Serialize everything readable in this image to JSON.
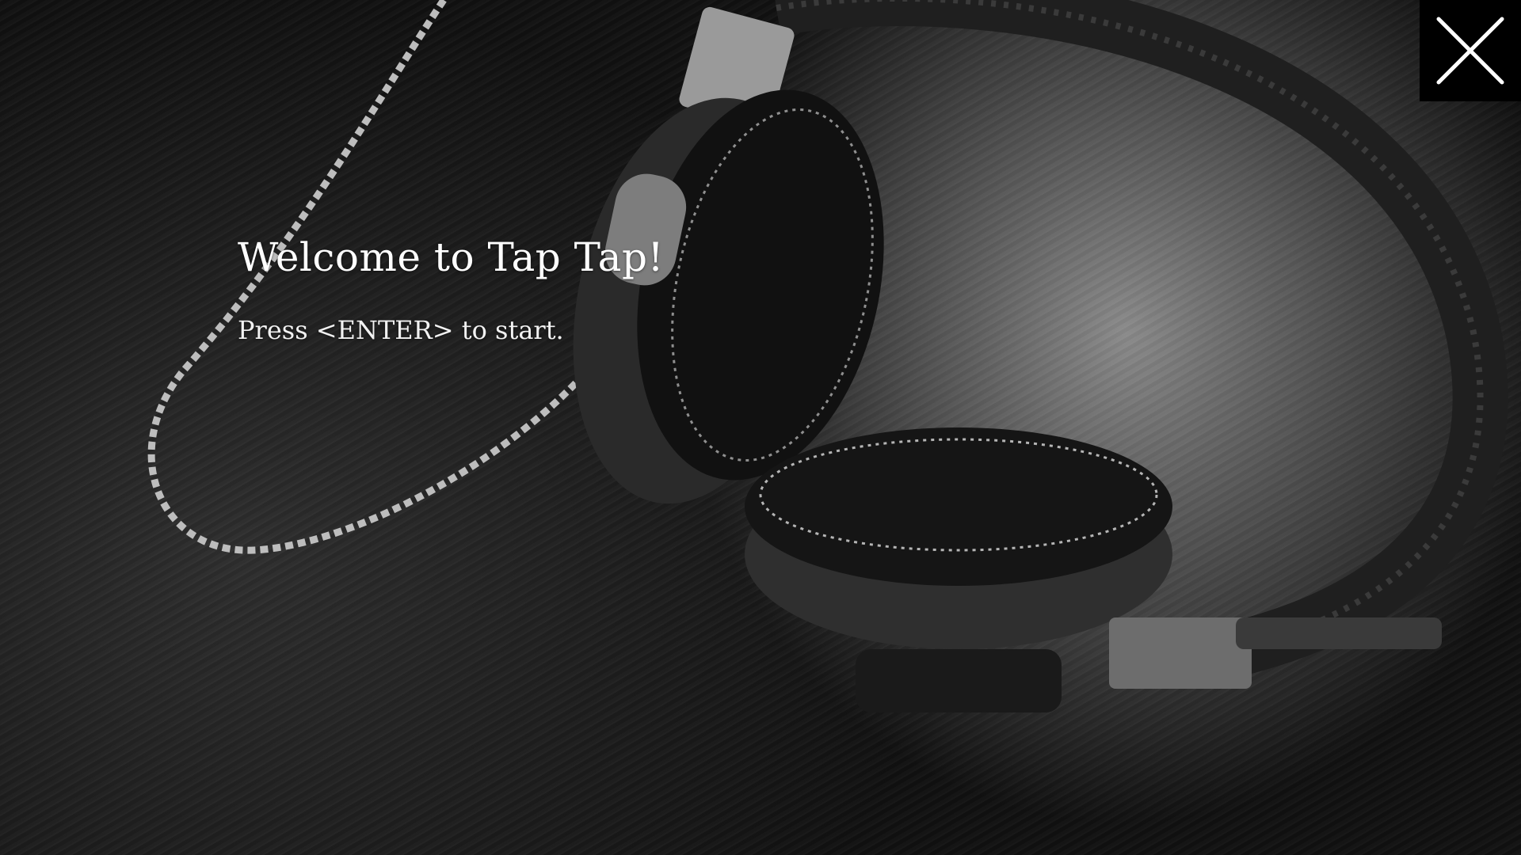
{
  "background": {
    "subject": "headphones-photo",
    "tone": "grayscale"
  },
  "welcome": {
    "title": "Welcome to Tap Tap!",
    "instruction": "Press <ENTER> to start."
  },
  "close": {
    "icon": "close-icon",
    "color": "#000000"
  }
}
